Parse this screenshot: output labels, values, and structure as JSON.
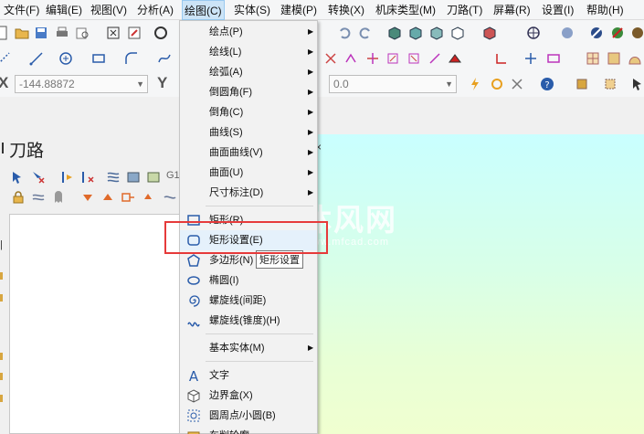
{
  "menubar": {
    "items": [
      "文件(F)",
      "编辑(E)",
      "视图(V)",
      "分析(A)",
      "绘图(C)",
      "实体(S)",
      "建模(P)",
      "转换(X)",
      "机床类型(M)",
      "刀路(T)",
      "屏幕(R)",
      "设置(I)",
      "帮助(H)"
    ],
    "active_index": 4
  },
  "coords": {
    "x_label": "X",
    "x_value": "-144.88872",
    "y_label": "Y",
    "z_value": "0.0"
  },
  "panel": {
    "title": "刀路"
  },
  "draw_menu": {
    "items": [
      {
        "label": "绘点(P)",
        "submenu": true,
        "icon": ""
      },
      {
        "label": "绘线(L)",
        "submenu": true,
        "icon": ""
      },
      {
        "label": "绘弧(A)",
        "submenu": true,
        "icon": ""
      },
      {
        "label": "倒圆角(F)",
        "submenu": true,
        "icon": ""
      },
      {
        "label": "倒角(C)",
        "submenu": true,
        "icon": ""
      },
      {
        "label": "曲线(S)",
        "submenu": true,
        "icon": ""
      },
      {
        "label": "曲面曲线(V)",
        "submenu": true,
        "icon": ""
      },
      {
        "label": "曲面(U)",
        "submenu": true,
        "icon": ""
      },
      {
        "label": "尺寸标注(D)",
        "submenu": true,
        "icon": ""
      },
      {
        "label": "矩形(R)",
        "submenu": false,
        "icon": "rectangle-icon"
      },
      {
        "label": "矩形设置(E)",
        "submenu": false,
        "icon": "rounded-rectangle-icon"
      },
      {
        "label": "多边形(N)",
        "submenu": false,
        "icon": "polygon-icon"
      },
      {
        "label": "椭圆(I)",
        "submenu": false,
        "icon": "ellipse-icon"
      },
      {
        "label": "螺旋线(间距)",
        "submenu": false,
        "icon": "spiral-icon"
      },
      {
        "label": "螺旋线(锥度)(H)",
        "submenu": false,
        "icon": "helix-icon"
      },
      {
        "label": "基本实体(M)",
        "submenu": true,
        "icon": ""
      },
      {
        "label": "文字",
        "submenu": false,
        "icon": "text-icon"
      },
      {
        "label": "边界盒(X)",
        "submenu": false,
        "icon": "bounding-box-icon"
      },
      {
        "label": "圆周点/小圆(B)",
        "submenu": false,
        "icon": "bolt-circle-icon"
      },
      {
        "label": "车削轮廓",
        "submenu": false,
        "icon": "turn-profile-icon"
      }
    ],
    "highlighted_index": 10
  },
  "tooltip": {
    "text": "矩形设置"
  },
  "watermark": {
    "text": "沐风网",
    "url": "www.mfcad.com"
  },
  "colors": {
    "menu_highlight": "#e5f1fb",
    "annotation_red": "#e63a3a",
    "viewport_top": "#c9ffff",
    "viewport_bottom": "#f0ffd0"
  }
}
